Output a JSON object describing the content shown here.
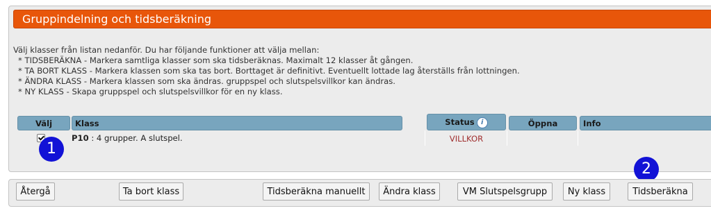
{
  "header": {
    "title": "Gruppindelning och tidsberäkning"
  },
  "instructions": {
    "intro": "Välj klasser från listan nedanför. Du har följande funktioner att välja mellan:",
    "items": [
      "* TIDSBERÄKNA - Markera samtliga klasser som ska tidsberäknas. Maximalt 12 klasser åt gången.",
      "* TA BORT KLASS - Markera klassen som ska tas bort. Borttaget är definitivt. Eventuellt lottade lag återställs från lottningen.",
      "* ÄNDRA KLASS - Markera klassen som ska ändras. gruppspel och slutspelsvillkor kan ändras.",
      "* NY KLASS - Skapa gruppspel och slutspelsvillkor för en ny klass."
    ]
  },
  "table": {
    "columns": {
      "select": "Välj",
      "class": "Klass",
      "status": "Status",
      "open": "Öppna",
      "info": "Info"
    },
    "status_info_icon": "info-icon",
    "rows": [
      {
        "selected": true,
        "class_code": "P10",
        "class_desc": " : 4 grupper. A slutspel.",
        "status": "VILLKOR",
        "open": "",
        "info": ""
      }
    ]
  },
  "annotations": {
    "badge1": "1",
    "badge2": "2"
  },
  "buttons": {
    "back": "Återgå",
    "remove_class": "Ta bort klass",
    "time_manual": "Tidsberäkna manuellt",
    "change_class": "Ändra klass",
    "vm_playoff": "VM Slutspelsgrupp",
    "new_class": "Ny klass",
    "time_calc": "Tidsberäkna"
  },
  "colors": {
    "title_bar": "#e8560a",
    "column_header": "#78a5be",
    "status_text": "#a03030",
    "badge": "#1212d6"
  }
}
